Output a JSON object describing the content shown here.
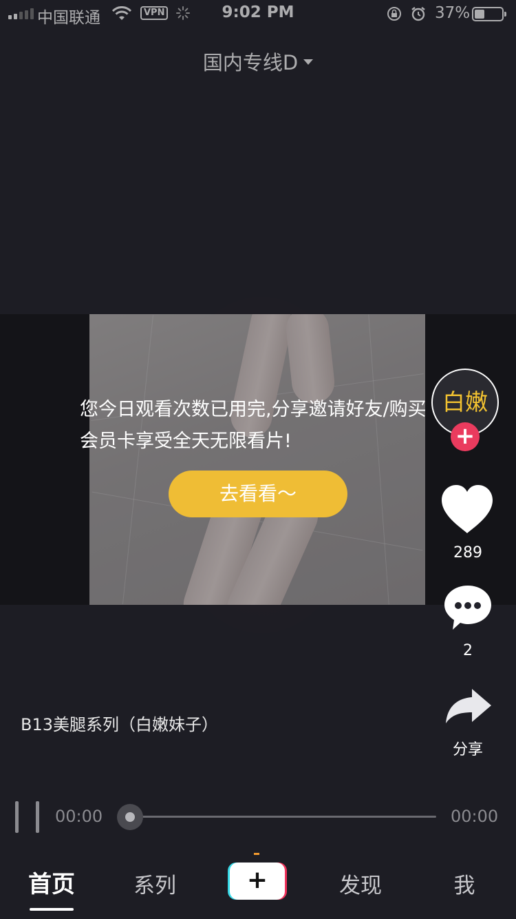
{
  "status_bar": {
    "carrier": "中国联通",
    "vpn": "VPN",
    "time": "9:02 PM",
    "battery_percent": "37%",
    "battery_level": 0.37,
    "signal_bars_filled": 2,
    "signal_bars_total": 5
  },
  "header": {
    "channel_title": "国内专线D"
  },
  "notice": {
    "message": "您今日观看次数已用完,分享邀请好友/购买会员卡享受全天无限看片!",
    "button_label": "去看看～"
  },
  "author": {
    "avatar_text": "白嫩",
    "follow_symbol": "+"
  },
  "actions": {
    "like_count": "289",
    "comment_count": "2",
    "share_label": "分享"
  },
  "video": {
    "title": "B13美腿系列（白嫩妹子）"
  },
  "player": {
    "current_time": "00:00",
    "duration": "00:00",
    "progress": 0.0
  },
  "tab_bar": {
    "tabs": [
      "首页",
      "系列",
      "发现",
      "我"
    ],
    "add_symbol": "+",
    "active_tab": "首页"
  },
  "colors": {
    "background": "#22222a",
    "accent_yellow": "#efbd35",
    "follow_red": "#ea3b5e",
    "progress_orange": "#f29a2e"
  }
}
